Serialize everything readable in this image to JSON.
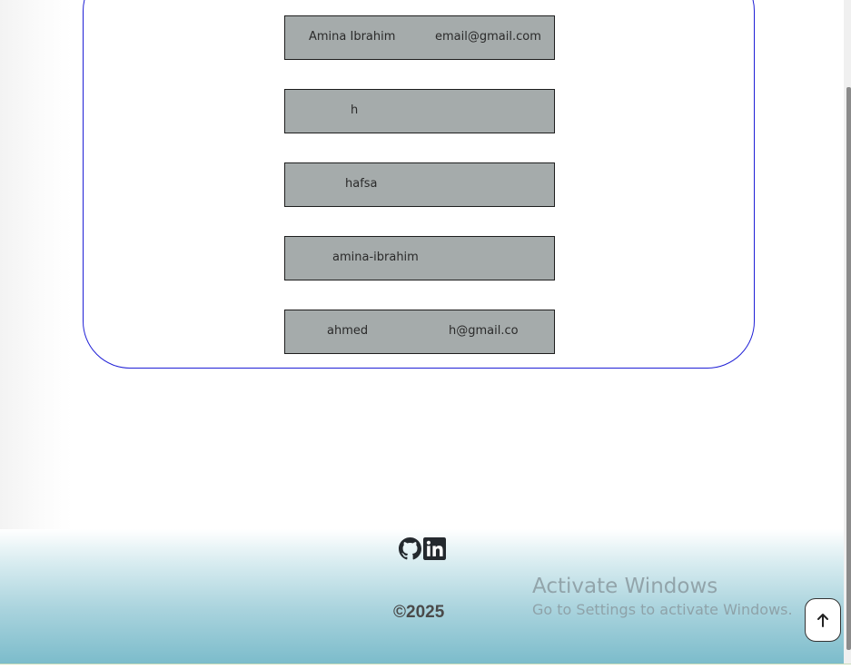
{
  "users": [
    {
      "name": "Amina Ibrahim",
      "email": "email@gmail.com"
    },
    {
      "name": "h",
      "email": ""
    },
    {
      "name": "hafsa",
      "email": ""
    },
    {
      "name": "amina-ibrahim",
      "email": ""
    },
    {
      "name": "ahmed",
      "email": "h@gmail.co"
    }
  ],
  "footer": {
    "social_icons": [
      "github-icon",
      "linkedin-icon"
    ],
    "copyright": "©2025"
  },
  "watermark": {
    "title": "Activate Windows",
    "subtitle": "Go to Settings to activate Windows."
  },
  "scroll_top_icon": "arrow-up-icon",
  "colors": {
    "panel_border": "#1f1fd6",
    "card_bg": "#a5abab",
    "footer_gradient_end": "#7cbccb"
  }
}
